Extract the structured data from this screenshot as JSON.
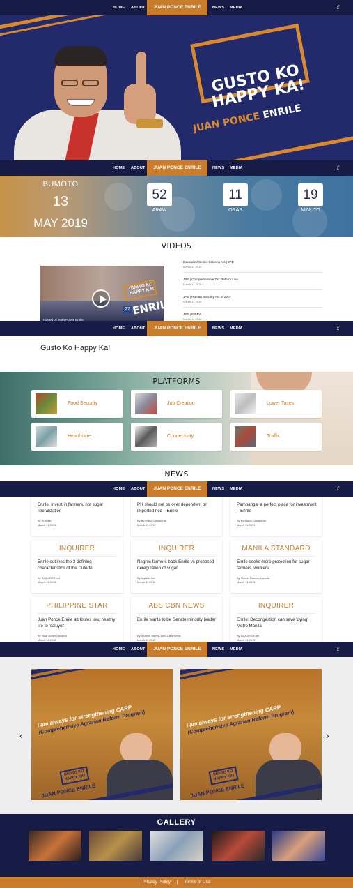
{
  "nav": {
    "home": "HOME",
    "about": "ABOUT",
    "brand": "JUAN PONCE ENRILE",
    "news": "NEWS",
    "media": "MEDIA",
    "facebook": "f"
  },
  "hero": {
    "slogan_line1": "GUSTO KO",
    "slogan_line2": "HAPPY KA!",
    "name_first": "JUAN PONCE",
    "name_last": "ENRILE"
  },
  "countdown": {
    "label": "BUMOTO",
    "day": "13",
    "month_year": "MAY 2019",
    "days_value": "52",
    "days_label": "ARAW",
    "hours_value": "11",
    "hours_label": "ORAS",
    "minutes_value": "19",
    "minutes_label": "MINUTO"
  },
  "videos": {
    "title": "VIDEOS",
    "thumb_caption": "Posted by Juan Ponce Enrile",
    "thumb_badge": "27",
    "list": [
      {
        "title": "Expanded Senior Citizens Act | JPE",
        "date": "March 11 2019"
      },
      {
        "title": "JPE | Comprehensive Tax Reform Law",
        "date": "March 11 2019"
      },
      {
        "title": "JPE | Human Security Act of 2007",
        "date": "March 11 2019"
      },
      {
        "title": "JPE | EPIRA",
        "date": "March 11 2019"
      }
    ]
  },
  "tagline": "Gusto Ko Happy Ka!",
  "platforms": {
    "title": "PLATFORMS",
    "items": [
      {
        "label": "Food Security"
      },
      {
        "label": "Job Creation"
      },
      {
        "label": "Lower Taxes"
      },
      {
        "label": "Healthcare"
      },
      {
        "label": "Connectivity"
      },
      {
        "label": "Traffic"
      }
    ]
  },
  "news": {
    "title": "NEWS",
    "row1": [
      {
        "title": "Enrile: Invest in farmers, not sugar liberalization",
        "by": "By Sunstar",
        "date": "March 11 2019"
      },
      {
        "title": "PH should not be over dependent on imported rice – Enrile",
        "by": "By By Mario Casayuran",
        "date": "March 11 2019"
      },
      {
        "title": "Pampanga, a perfect place for investment – Enrile",
        "by": "By By Mario Casayuran",
        "date": "March 11 2019"
      }
    ],
    "row2": [
      {
        "source": "INQUIRER",
        "title": "Enrile outlines the 3 defining characteristics of the Duterte",
        "by": "By INQUIRER.net",
        "date": "March 11 2019"
      },
      {
        "source": "INQUIRER",
        "title": "Negros farmers back Enrile vs proposed deregulation of sugar",
        "by": "By Inquirer.net",
        "date": "March 11 2019"
      },
      {
        "source": "MANILA STANDARD",
        "title": "Enrile seeks more protection for sugar farmers, workers",
        "by": "By Macon Ramos-Araneta",
        "date": "March 11 2019"
      }
    ],
    "row3": [
      {
        "source": "PHILIPPINE STAR",
        "title": "Juan Ponce Enrile attributes low, healthy life to 'saluyot'",
        "by": "By Jose Rodel Clapano",
        "date": "March 11 2019"
      },
      {
        "source": "ABS CBN NEWS",
        "title": "Enrile wants to be Senate minority leader",
        "by": "By Arianne Merez, ABS-CBN News",
        "date": "March 11 2019"
      },
      {
        "source": "INQUIRER",
        "title": "Enrile: Decongestion can save 'dying' Metro Manila",
        "by": "By INQUIRER.net",
        "date": "March 11 2019"
      }
    ]
  },
  "carousel": {
    "prev": "‹",
    "next": "›",
    "quote_line1": "I am always for strengthening CARP",
    "quote_line2": "(Comprehensive Agrarian Reform Program)",
    "logo_line1": "GUSTO KO",
    "logo_line2": "HAPPY KA!",
    "name": "JUAN PONCE ENRILE"
  },
  "gallery": {
    "title": "GALLERY"
  },
  "footer": {
    "privacy": "Privacy Policy",
    "separator": "|",
    "terms": "Terms of Use"
  }
}
